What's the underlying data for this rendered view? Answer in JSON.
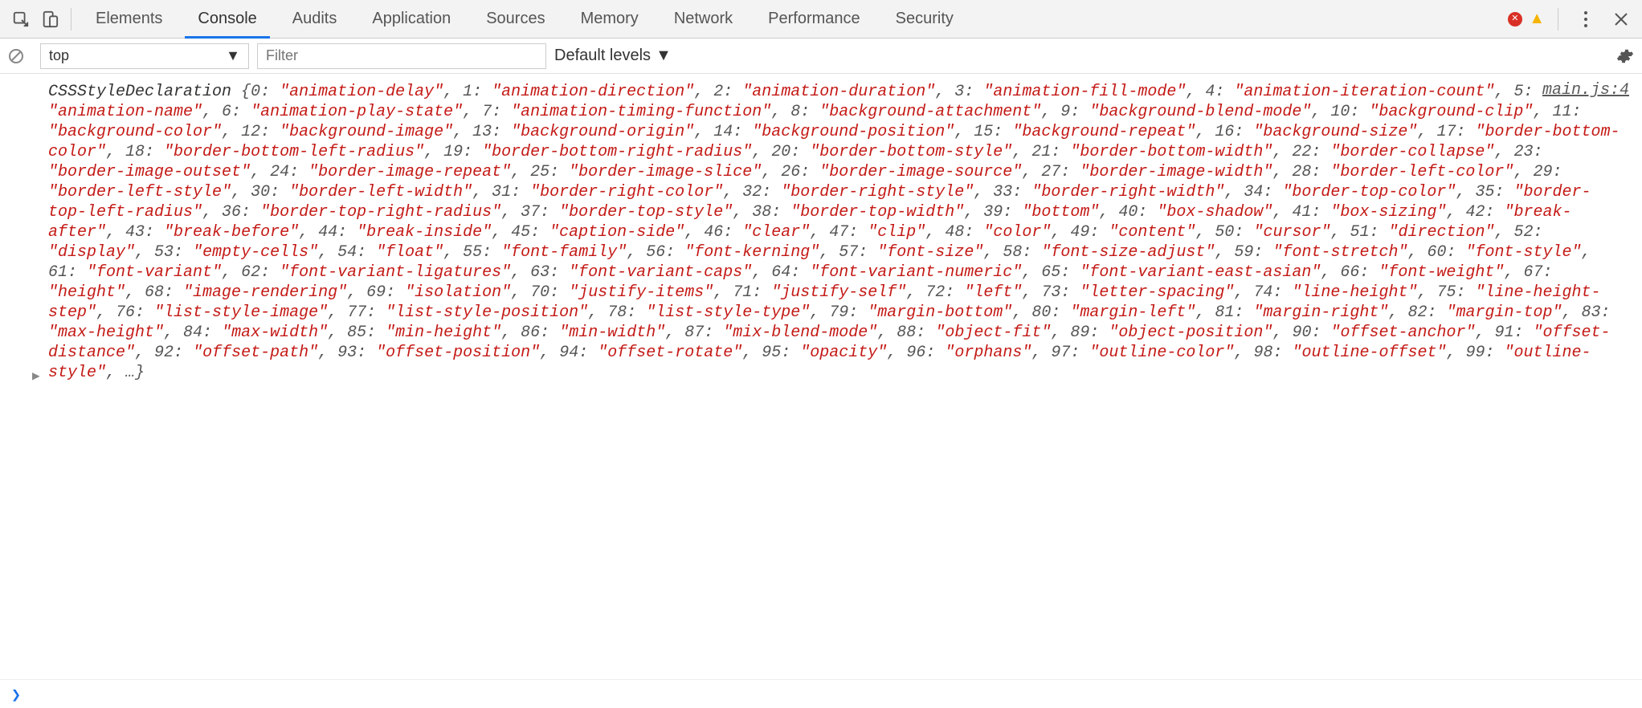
{
  "tabs": {
    "items": [
      "Elements",
      "Console",
      "Audits",
      "Application",
      "Sources",
      "Memory",
      "Network",
      "Performance",
      "Security"
    ],
    "active_index": 1
  },
  "toolbar": {
    "context": "top",
    "filter_placeholder": "Filter",
    "levels_label": "Default levels"
  },
  "source_link": "main.js:4",
  "prompt": "❯",
  "log_entry": {
    "prefix": "CSSStyleDeclaration",
    "trailing": "…}",
    "pairs": [
      {
        "k": "0",
        "v": "animation-delay"
      },
      {
        "k": "1",
        "v": "animation-direction"
      },
      {
        "k": "2",
        "v": "animation-duration"
      },
      {
        "k": "3",
        "v": "animation-fill-mode"
      },
      {
        "k": "4",
        "v": "animation-iteration-count"
      },
      {
        "k": "5",
        "v": "animation-name"
      },
      {
        "k": "6",
        "v": "animation-play-state"
      },
      {
        "k": "7",
        "v": "animation-timing-function"
      },
      {
        "k": "8",
        "v": "background-attachment"
      },
      {
        "k": "9",
        "v": "background-blend-mode"
      },
      {
        "k": "10",
        "v": "background-clip"
      },
      {
        "k": "11",
        "v": "background-color"
      },
      {
        "k": "12",
        "v": "background-image"
      },
      {
        "k": "13",
        "v": "background-origin"
      },
      {
        "k": "14",
        "v": "background-position"
      },
      {
        "k": "15",
        "v": "background-repeat"
      },
      {
        "k": "16",
        "v": "background-size"
      },
      {
        "k": "17",
        "v": "border-bottom-color"
      },
      {
        "k": "18",
        "v": "border-bottom-left-radius"
      },
      {
        "k": "19",
        "v": "border-bottom-right-radius"
      },
      {
        "k": "20",
        "v": "border-bottom-style"
      },
      {
        "k": "21",
        "v": "border-bottom-width"
      },
      {
        "k": "22",
        "v": "border-collapse"
      },
      {
        "k": "23",
        "v": "border-image-outset"
      },
      {
        "k": "24",
        "v": "border-image-repeat"
      },
      {
        "k": "25",
        "v": "border-image-slice"
      },
      {
        "k": "26",
        "v": "border-image-source"
      },
      {
        "k": "27",
        "v": "border-image-width"
      },
      {
        "k": "28",
        "v": "border-left-color"
      },
      {
        "k": "29",
        "v": "border-left-style"
      },
      {
        "k": "30",
        "v": "border-left-width"
      },
      {
        "k": "31",
        "v": "border-right-color"
      },
      {
        "k": "32",
        "v": "border-right-style"
      },
      {
        "k": "33",
        "v": "border-right-width"
      },
      {
        "k": "34",
        "v": "border-top-color"
      },
      {
        "k": "35",
        "v": "border-top-left-radius"
      },
      {
        "k": "36",
        "v": "border-top-right-radius"
      },
      {
        "k": "37",
        "v": "border-top-style"
      },
      {
        "k": "38",
        "v": "border-top-width"
      },
      {
        "k": "39",
        "v": "bottom"
      },
      {
        "k": "40",
        "v": "box-shadow"
      },
      {
        "k": "41",
        "v": "box-sizing"
      },
      {
        "k": "42",
        "v": "break-after"
      },
      {
        "k": "43",
        "v": "break-before"
      },
      {
        "k": "44",
        "v": "break-inside"
      },
      {
        "k": "45",
        "v": "caption-side"
      },
      {
        "k": "46",
        "v": "clear"
      },
      {
        "k": "47",
        "v": "clip"
      },
      {
        "k": "48",
        "v": "color"
      },
      {
        "k": "49",
        "v": "content"
      },
      {
        "k": "50",
        "v": "cursor"
      },
      {
        "k": "51",
        "v": "direction"
      },
      {
        "k": "52",
        "v": "display"
      },
      {
        "k": "53",
        "v": "empty-cells"
      },
      {
        "k": "54",
        "v": "float"
      },
      {
        "k": "55",
        "v": "font-family"
      },
      {
        "k": "56",
        "v": "font-kerning"
      },
      {
        "k": "57",
        "v": "font-size"
      },
      {
        "k": "58",
        "v": "font-size-adjust"
      },
      {
        "k": "59",
        "v": "font-stretch"
      },
      {
        "k": "60",
        "v": "font-style"
      },
      {
        "k": "61",
        "v": "font-variant"
      },
      {
        "k": "62",
        "v": "font-variant-ligatures"
      },
      {
        "k": "63",
        "v": "font-variant-caps"
      },
      {
        "k": "64",
        "v": "font-variant-numeric"
      },
      {
        "k": "65",
        "v": "font-variant-east-asian"
      },
      {
        "k": "66",
        "v": "font-weight"
      },
      {
        "k": "67",
        "v": "height"
      },
      {
        "k": "68",
        "v": "image-rendering"
      },
      {
        "k": "69",
        "v": "isolation"
      },
      {
        "k": "70",
        "v": "justify-items"
      },
      {
        "k": "71",
        "v": "justify-self"
      },
      {
        "k": "72",
        "v": "left"
      },
      {
        "k": "73",
        "v": "letter-spacing"
      },
      {
        "k": "74",
        "v": "line-height"
      },
      {
        "k": "75",
        "v": "line-height-step"
      },
      {
        "k": "76",
        "v": "list-style-image"
      },
      {
        "k": "77",
        "v": "list-style-position"
      },
      {
        "k": "78",
        "v": "list-style-type"
      },
      {
        "k": "79",
        "v": "margin-bottom"
      },
      {
        "k": "80",
        "v": "margin-left"
      },
      {
        "k": "81",
        "v": "margin-right"
      },
      {
        "k": "82",
        "v": "margin-top"
      },
      {
        "k": "83",
        "v": "max-height"
      },
      {
        "k": "84",
        "v": "max-width"
      },
      {
        "k": "85",
        "v": "min-height"
      },
      {
        "k": "86",
        "v": "min-width"
      },
      {
        "k": "87",
        "v": "mix-blend-mode"
      },
      {
        "k": "88",
        "v": "object-fit"
      },
      {
        "k": "89",
        "v": "object-position"
      },
      {
        "k": "90",
        "v": "offset-anchor"
      },
      {
        "k": "91",
        "v": "offset-distance"
      },
      {
        "k": "92",
        "v": "offset-path"
      },
      {
        "k": "93",
        "v": "offset-position"
      },
      {
        "k": "94",
        "v": "offset-rotate"
      },
      {
        "k": "95",
        "v": "opacity"
      },
      {
        "k": "96",
        "v": "orphans"
      },
      {
        "k": "97",
        "v": "outline-color"
      },
      {
        "k": "98",
        "v": "outline-offset"
      },
      {
        "k": "99",
        "v": "outline-style"
      }
    ]
  }
}
